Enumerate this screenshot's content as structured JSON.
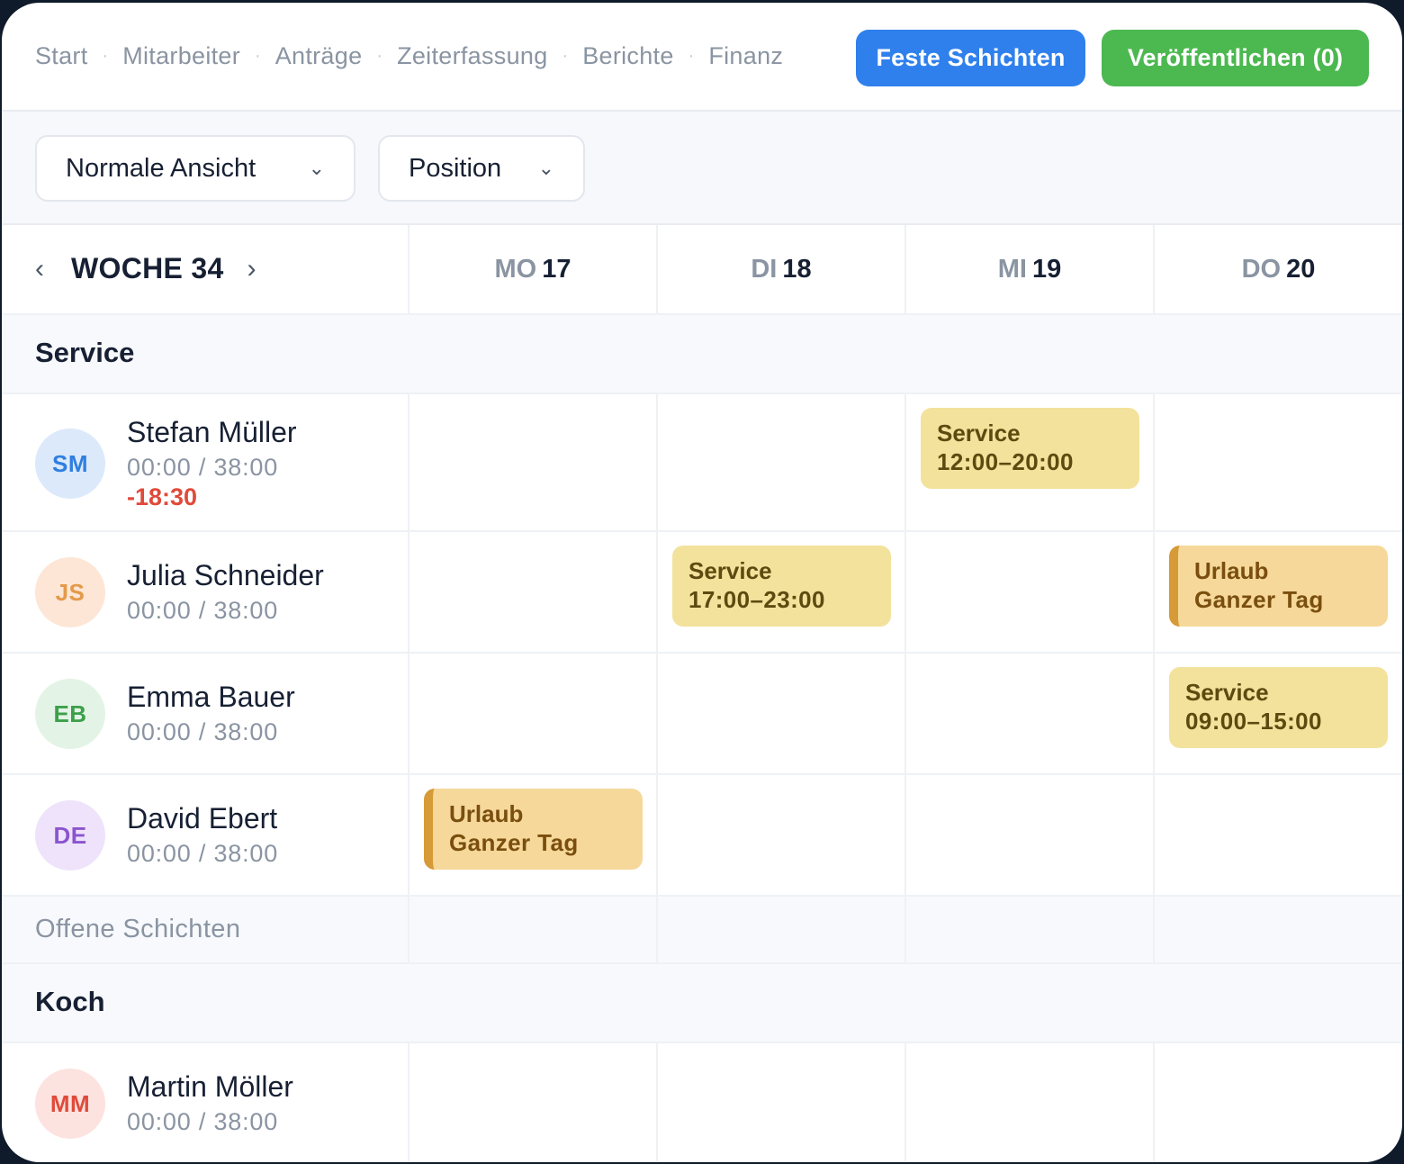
{
  "nav": {
    "items": [
      "Start",
      "Mitarbeiter",
      "Anträge",
      "Zeiterfassung",
      "Berichte",
      "Finanz"
    ],
    "separator": "·",
    "fixed_shifts_label": "Feste Schichten",
    "publish_label": "Veröffentlichen (0)"
  },
  "filters": {
    "view": "Normale Ansicht",
    "group_by": "Position"
  },
  "week": {
    "label": "WOCHE 34",
    "prev": "‹",
    "next": "›",
    "days": [
      {
        "name": "MO",
        "date": "17"
      },
      {
        "name": "DI",
        "date": "18"
      },
      {
        "name": "MI",
        "date": "19"
      },
      {
        "name": "DO",
        "date": "20"
      }
    ]
  },
  "groups": [
    {
      "title": "Service",
      "employees": [
        {
          "initials": "SM",
          "name": "Stefan Müller",
          "hours": "00:00 / 38:00",
          "diff": "-18:30",
          "shifts": [
            null,
            null,
            {
              "type": "Service",
              "time": "12:00–20:00"
            },
            null
          ]
        },
        {
          "initials": "JS",
          "name": "Julia Schneider",
          "hours": "00:00 / 38:00",
          "shifts": [
            null,
            {
              "type": "Service",
              "time": "17:00–23:00"
            },
            null,
            {
              "type": "Urlaub",
              "time": "Ganzer Tag"
            }
          ]
        },
        {
          "initials": "EB",
          "name": "Emma Bauer",
          "hours": "00:00 / 38:00",
          "shifts": [
            null,
            null,
            null,
            {
              "type": "Service",
              "time": "09:00–15:00"
            }
          ]
        },
        {
          "initials": "DE",
          "name": "David Ebert",
          "hours": "00:00 / 38:00",
          "shifts": [
            {
              "type": "Urlaub",
              "time": "Ganzer Tag"
            },
            null,
            null,
            null
          ]
        }
      ],
      "open_shifts_label": "Offene Schichten"
    },
    {
      "title": "Koch",
      "employees": [
        {
          "initials": "MM",
          "name": "Martin Möller",
          "hours": "00:00 / 38:00"
        }
      ]
    }
  ],
  "colors": {
    "primary": "#2f80ed",
    "success": "#4cb850",
    "shift": "#f3e29c",
    "leave": "#f5d89a",
    "negative": "#e04a3a"
  },
  "icons": {
    "dropdown": "chevron-down-icon",
    "prev_week": "chevron-left-icon",
    "next_week": "chevron-right-icon"
  }
}
